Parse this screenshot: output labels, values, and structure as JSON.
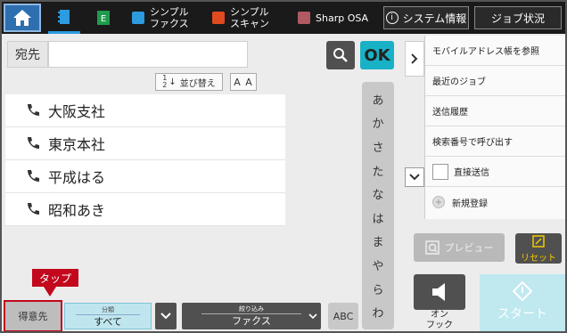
{
  "topbar": {
    "home_icon": "home-icon",
    "items": [
      {
        "label": "シンプル\nファクス",
        "icon": "fax-icon",
        "color": "#2c9be0"
      },
      {
        "label": "シンプル\nスキャン",
        "icon": "scan-icon",
        "color": "#e04a1f"
      },
      {
        "label": "Sharp OSA",
        "icon": "osa-icon",
        "color": "#b15a63"
      }
    ],
    "system_info": "システム情報",
    "job_status": "ジョブ状況"
  },
  "destination": {
    "label": "宛先",
    "value": "",
    "ok_label": "OK"
  },
  "sort": {
    "label": "並び替え",
    "order_sym_top": "1",
    "order_sym_bottom": "2",
    "fontsize_label": "A A"
  },
  "contacts": [
    {
      "name": "大阪支社"
    },
    {
      "name": "東京本社"
    },
    {
      "name": "平成はる"
    },
    {
      "name": "昭和あき"
    }
  ],
  "kana_index": [
    "あ",
    "か",
    "さ",
    "た",
    "な",
    "は",
    "ま",
    "や",
    "ら",
    "わ"
  ],
  "bottom": {
    "tap_label": "タップ",
    "tokui_label": "得意先",
    "category_caption": "分類",
    "category_value": "すべて",
    "filter_caption": "絞り込み",
    "filter_value": "ファクス",
    "abc_label": "ABC"
  },
  "right_menu": {
    "items": [
      {
        "label": "モバイルアドレス帳を参照"
      },
      {
        "label": "最近のジョブ"
      },
      {
        "label": "送信履歴"
      },
      {
        "label": "検索番号で呼び出す"
      }
    ],
    "direct_send": "直接送信",
    "new_register": "新規登録"
  },
  "actions": {
    "preview_label": "プレビュー",
    "reset_label": "リセット",
    "onhook_label": "オン\nフック",
    "start_label": "スタート"
  },
  "colors": {
    "accent": "#19b1c6",
    "tap_red": "#c3071c",
    "reset_yellow": "#f5c800"
  }
}
